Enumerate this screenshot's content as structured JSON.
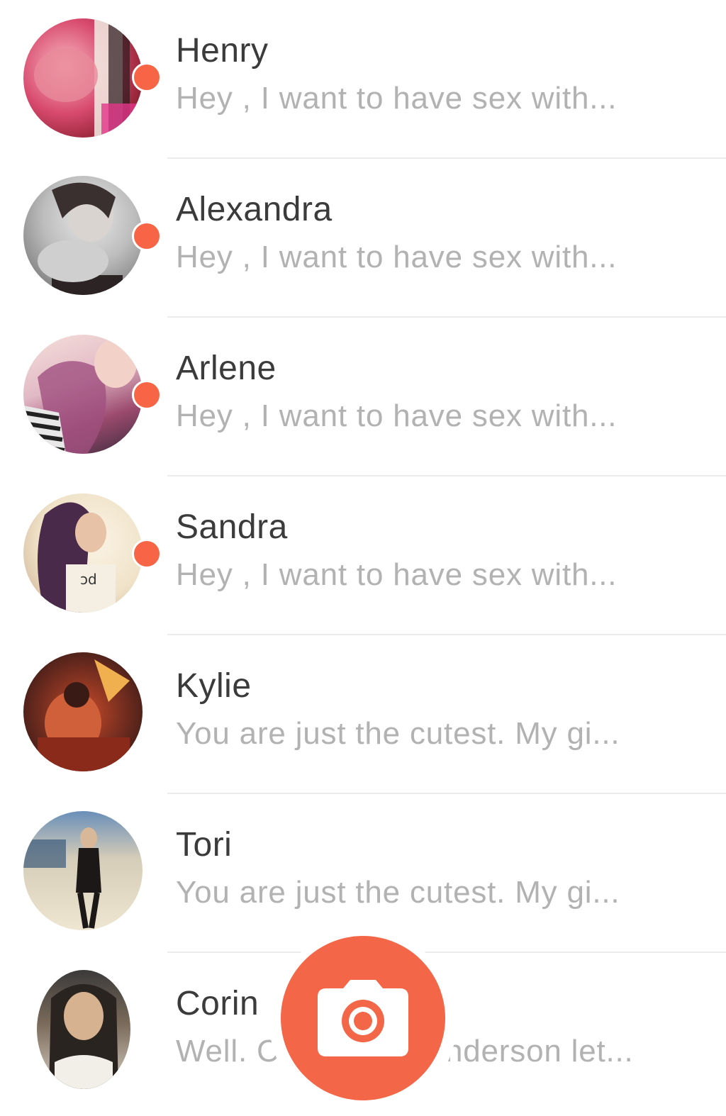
{
  "conversations": [
    {
      "name": "Henry",
      "preview": "Hey , I want to have sex with...",
      "unread": true,
      "avatar_icon": "user-photo-icon",
      "avatar_colors": [
        "#d84a6e",
        "#f7b6c0",
        "#8a1e2e"
      ]
    },
    {
      "name": "Alexandra",
      "preview": "Hey , I want to have sex with...",
      "unread": true,
      "avatar_icon": "user-photo-icon",
      "avatar_colors": [
        "#cfcfcf",
        "#8d8d8d",
        "#3e3434"
      ]
    },
    {
      "name": "Arlene",
      "preview": "Hey , I want to have sex with...",
      "unread": true,
      "avatar_icon": "user-photo-icon",
      "avatar_colors": [
        "#f3d7cf",
        "#9b4a6e",
        "#2b2b2b"
      ]
    },
    {
      "name": "Sandra",
      "preview": "Hey , I want to have sex with...",
      "unread": true,
      "avatar_icon": "user-photo-icon",
      "avatar_colors": [
        "#f1e7d6",
        "#5a3a4a",
        "#caa28a"
      ]
    },
    {
      "name": "Kylie",
      "preview": "You are just the cutest. My gi...",
      "unread": false,
      "avatar_icon": "user-photo-icon",
      "avatar_colors": [
        "#2c1c1c",
        "#c84a2a",
        "#f0b050"
      ]
    },
    {
      "name": "Tori",
      "preview": "You are just the cutest. My gi...",
      "unread": false,
      "avatar_icon": "user-photo-icon",
      "avatar_colors": [
        "#e7e0cf",
        "#1f1b1b",
        "#3b6ea8"
      ]
    },
    {
      "name": "Corin",
      "preview_left": "Well. C",
      "preview_right": "nderson let...",
      "unread": false,
      "avatar_icon": "user-photo-icon",
      "avatar_colors": [
        "#4a4a4a",
        "#c7a77f",
        "#1e1e1e"
      ]
    }
  ],
  "camera_button": {
    "icon": "camera-icon",
    "color": "#f46648"
  },
  "colors": {
    "unread_dot": "#f76446",
    "name_text": "#3b3b3b",
    "preview_text": "#b2b2b2"
  }
}
